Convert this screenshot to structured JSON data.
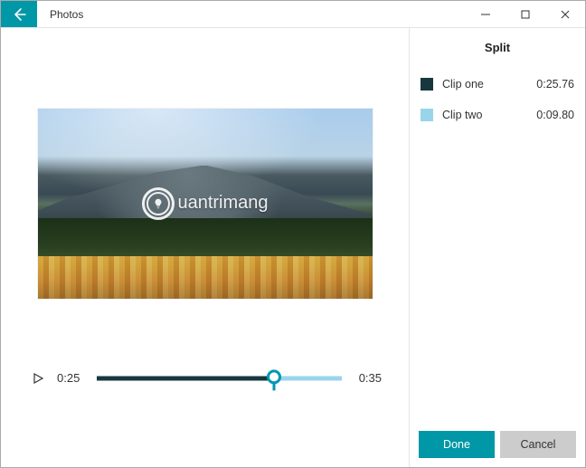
{
  "window": {
    "title": "Photos"
  },
  "preview": {
    "watermark": "uantrimang"
  },
  "timeline": {
    "current_time": "0:25",
    "total_time": "0:35",
    "split_percent": 72.5
  },
  "split_panel": {
    "title": "Split",
    "clips": [
      {
        "name": "Clip one",
        "duration": "0:25.76",
        "color": "#17373f"
      },
      {
        "name": "Clip two",
        "duration": "0:09.80",
        "color": "#98d5eb"
      }
    ],
    "done_label": "Done",
    "cancel_label": "Cancel"
  }
}
